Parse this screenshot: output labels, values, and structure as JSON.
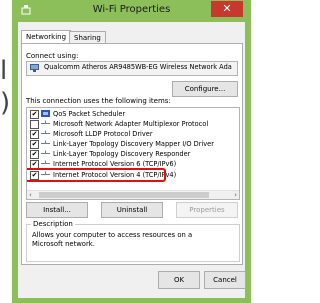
{
  "window": {
    "title": "Wi-Fi Properties",
    "close_glyph": "✕"
  },
  "background": {
    "letter_1": "l",
    "letter_2": ")"
  },
  "tabs": [
    {
      "label": "Networking"
    },
    {
      "label": "Sharing"
    }
  ],
  "connect": {
    "label": "Connect using:",
    "adapter": "Qualcomm Atheros AR9485WB-EG Wireless Network Ada",
    "configure_label": "Configure..."
  },
  "items_label": "This connection uses the following items:",
  "items": [
    {
      "label": "QoS Packet Scheduler",
      "checked": true,
      "check": "✔",
      "icon": "scheduler-icon"
    },
    {
      "label": "Microsoft Network Adapter Multiplexor Protocol",
      "checked": false,
      "check": "",
      "icon": "protocol-icon"
    },
    {
      "label": "Microsoft LLDP Protocol Driver",
      "checked": true,
      "check": "✔",
      "icon": "protocol-icon"
    },
    {
      "label": "Link-Layer Topology Discovery Mapper I/O Driver",
      "checked": true,
      "check": "✔",
      "icon": "protocol-icon"
    },
    {
      "label": "Link-Layer Topology Discovery Responder",
      "checked": true,
      "check": "✔",
      "icon": "protocol-icon"
    },
    {
      "label": "Internet Protocol Version 6 (TCP/IPv6)",
      "checked": true,
      "check": "✔",
      "icon": "protocol-icon"
    },
    {
      "label": "Internet Protocol Version 4 (TCP/IPv4)",
      "checked": true,
      "check": "✔",
      "icon": "protocol-icon"
    }
  ],
  "buttons": {
    "install": "Install...",
    "uninstall": "Uninstall",
    "properties": "Properties",
    "ok": "OK",
    "cancel": "Cancel"
  },
  "description": {
    "title": "Description",
    "text": "Allows your computer to access resources on a Microsoft network."
  },
  "colors": {
    "frame": "#8cbf5a",
    "close": "#c7392c",
    "highlight": "#e01010"
  }
}
